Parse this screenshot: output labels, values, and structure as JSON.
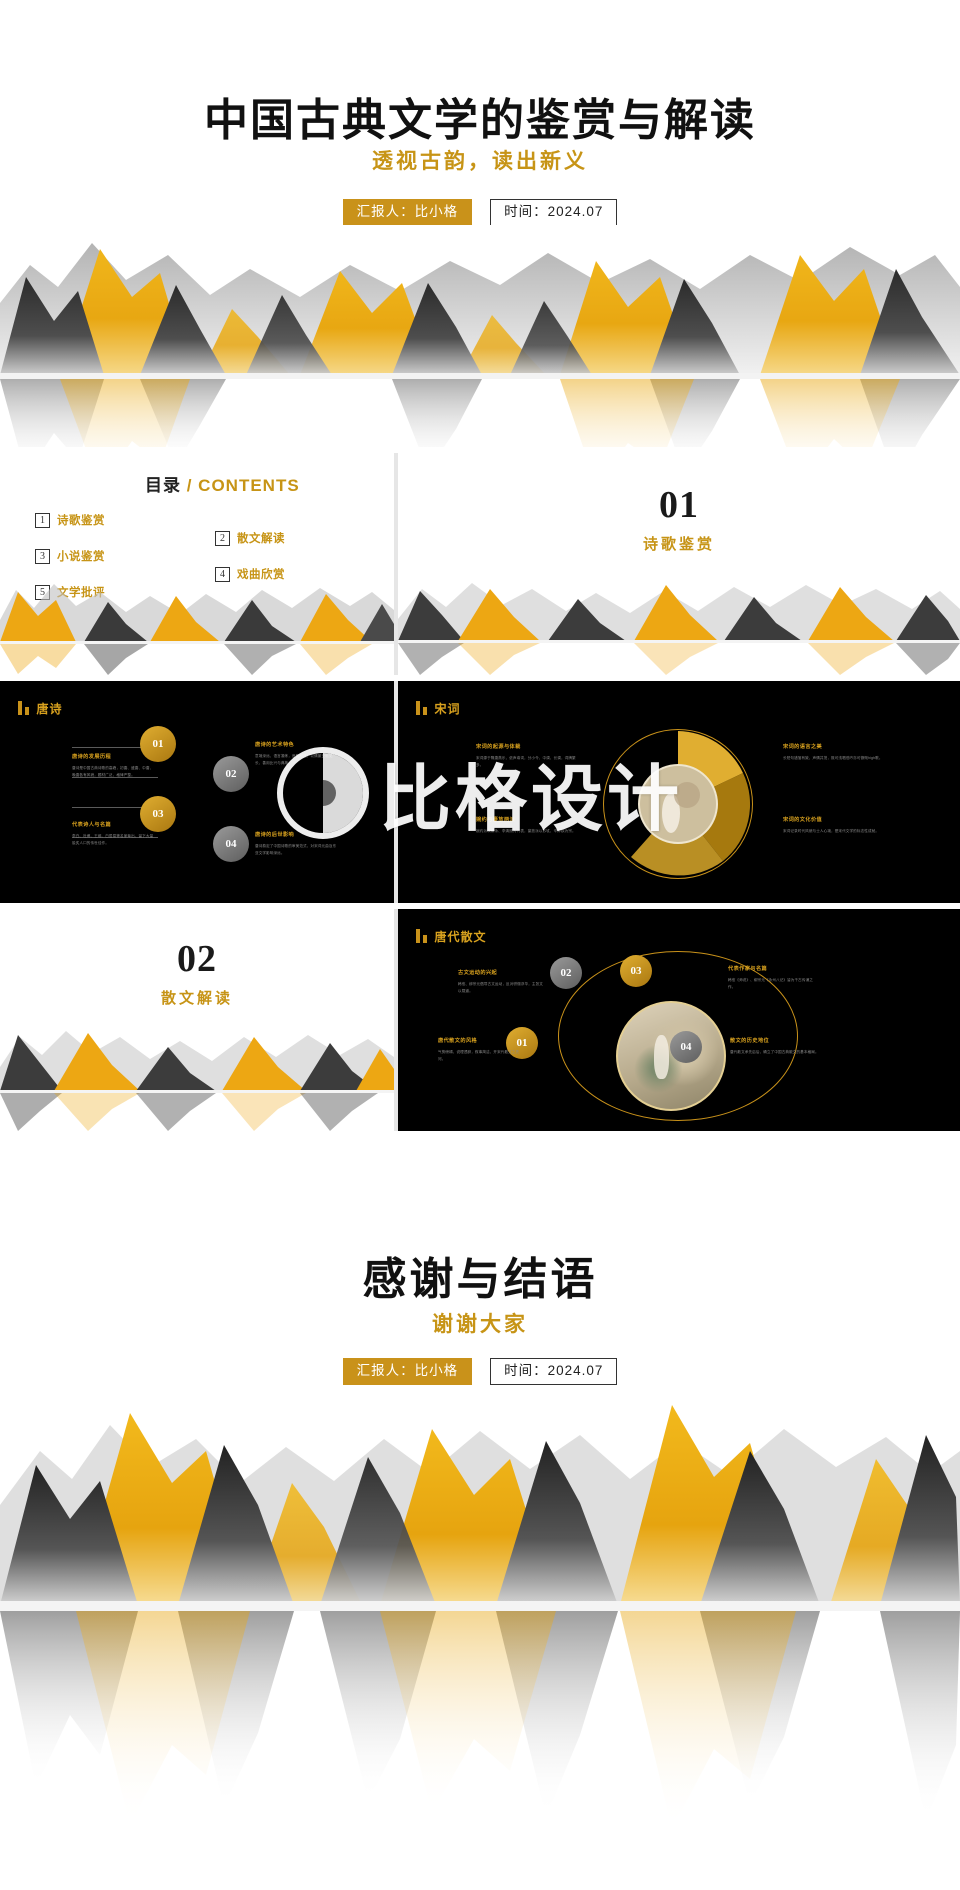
{
  "deck": {
    "cover": {
      "title": "中国古典文学的鉴赏与解读",
      "subtitle": "透视古韵，读出新义",
      "presenter_badge": "汇报人：比小格",
      "date_badge": "时间：2024.07"
    },
    "contents_slide": {
      "heading_cn": "目录",
      "heading_en": "/ CONTENTS",
      "items": [
        {
          "num": "1",
          "label": "诗歌鉴赏"
        },
        {
          "num": "2",
          "label": "散文解读"
        },
        {
          "num": "3",
          "label": "小说鉴赏"
        },
        {
          "num": "4",
          "label": "戏曲欣赏"
        },
        {
          "num": "5",
          "label": "文学批评"
        }
      ]
    },
    "section_01": {
      "number": "01",
      "label": "诗歌鉴赏"
    },
    "section_02": {
      "number": "02",
      "label": "散文解读"
    },
    "slide_tangshi": {
      "title": "唐诗",
      "nodes": [
        "01",
        "02",
        "03",
        "04"
      ],
      "blurbs": [
        {
          "title": "唐诗的发展历程",
          "body": "唐诗是中国古典诗歌的高峰，初唐、盛唐、中唐、晚唐各有风貌，题材广泛，格律严整。"
        },
        {
          "title": "唐诗的艺术特色",
          "body": "意境深远，语言凝练，音韵和谐，以情景交融见长，善用比兴与典故。"
        },
        {
          "title": "代表诗人与名篇",
          "body": "李白、杜甫、王维、白居易等名家辈出，留下大量脍炙人口的传世佳作。"
        },
        {
          "title": "唐诗的后世影响",
          "body": "唐诗奠定了中国诗歌的审美范式，对宋词元曲及东亚文学影响深远。"
        }
      ]
    },
    "slide_songci": {
      "title": "宋词",
      "blurbs": [
        {
          "title": "宋词的起源与体裁",
          "body": "宋词源于隋唐燕乐，依声填词，分小令、中调、长调，词牌繁多。"
        },
        {
          "title": "婉约与豪放两派",
          "body": "婉约派以柳永、李清照为代表，豪放派以苏轼、辛弃疾为宗。"
        },
        {
          "title": "宋词的语言之美",
          "body": "长短句错落有致，声情并茂，既可浅唱低吟亦可慷慨high歌。"
        },
        {
          "title": "宋词的文化价值",
          "body": "宋词记录时代风貌与士人心境，是宋代文学的标志性成就。"
        }
      ]
    },
    "slide_tangsanwen": {
      "title": "唐代散文",
      "nodes": [
        "01",
        "02",
        "03",
        "04"
      ],
      "blurbs": [
        {
          "title": "古文运动的兴起",
          "body": "韩愈、柳宗元倡导古文运动，反对骈俪浮华，主张文以载道。"
        },
        {
          "title": "唐代散文的风格",
          "body": "气势磅礴，说理透辟，叙事简洁，开宋代散文之先河。"
        },
        {
          "title": "代表作家与名篇",
          "body": "韩愈《师说》、柳宗元《永州八记》皆为千古传诵之作。"
        },
        {
          "title": "散文的历史地位",
          "body": "唐代散文承先启后，确立了中国古典散文的基本格局。"
        }
      ]
    },
    "thanks": {
      "title": "感谢与结语",
      "subtitle": "谢谢大家",
      "presenter_badge": "汇报人：比小格",
      "date_badge": "时间：2024.07"
    },
    "watermark": {
      "text": "比格设计"
    },
    "colors": {
      "gold": "#c9921a",
      "gold_text": "#c79416",
      "ink": "#111111",
      "dark_bg": "#000000"
    }
  }
}
